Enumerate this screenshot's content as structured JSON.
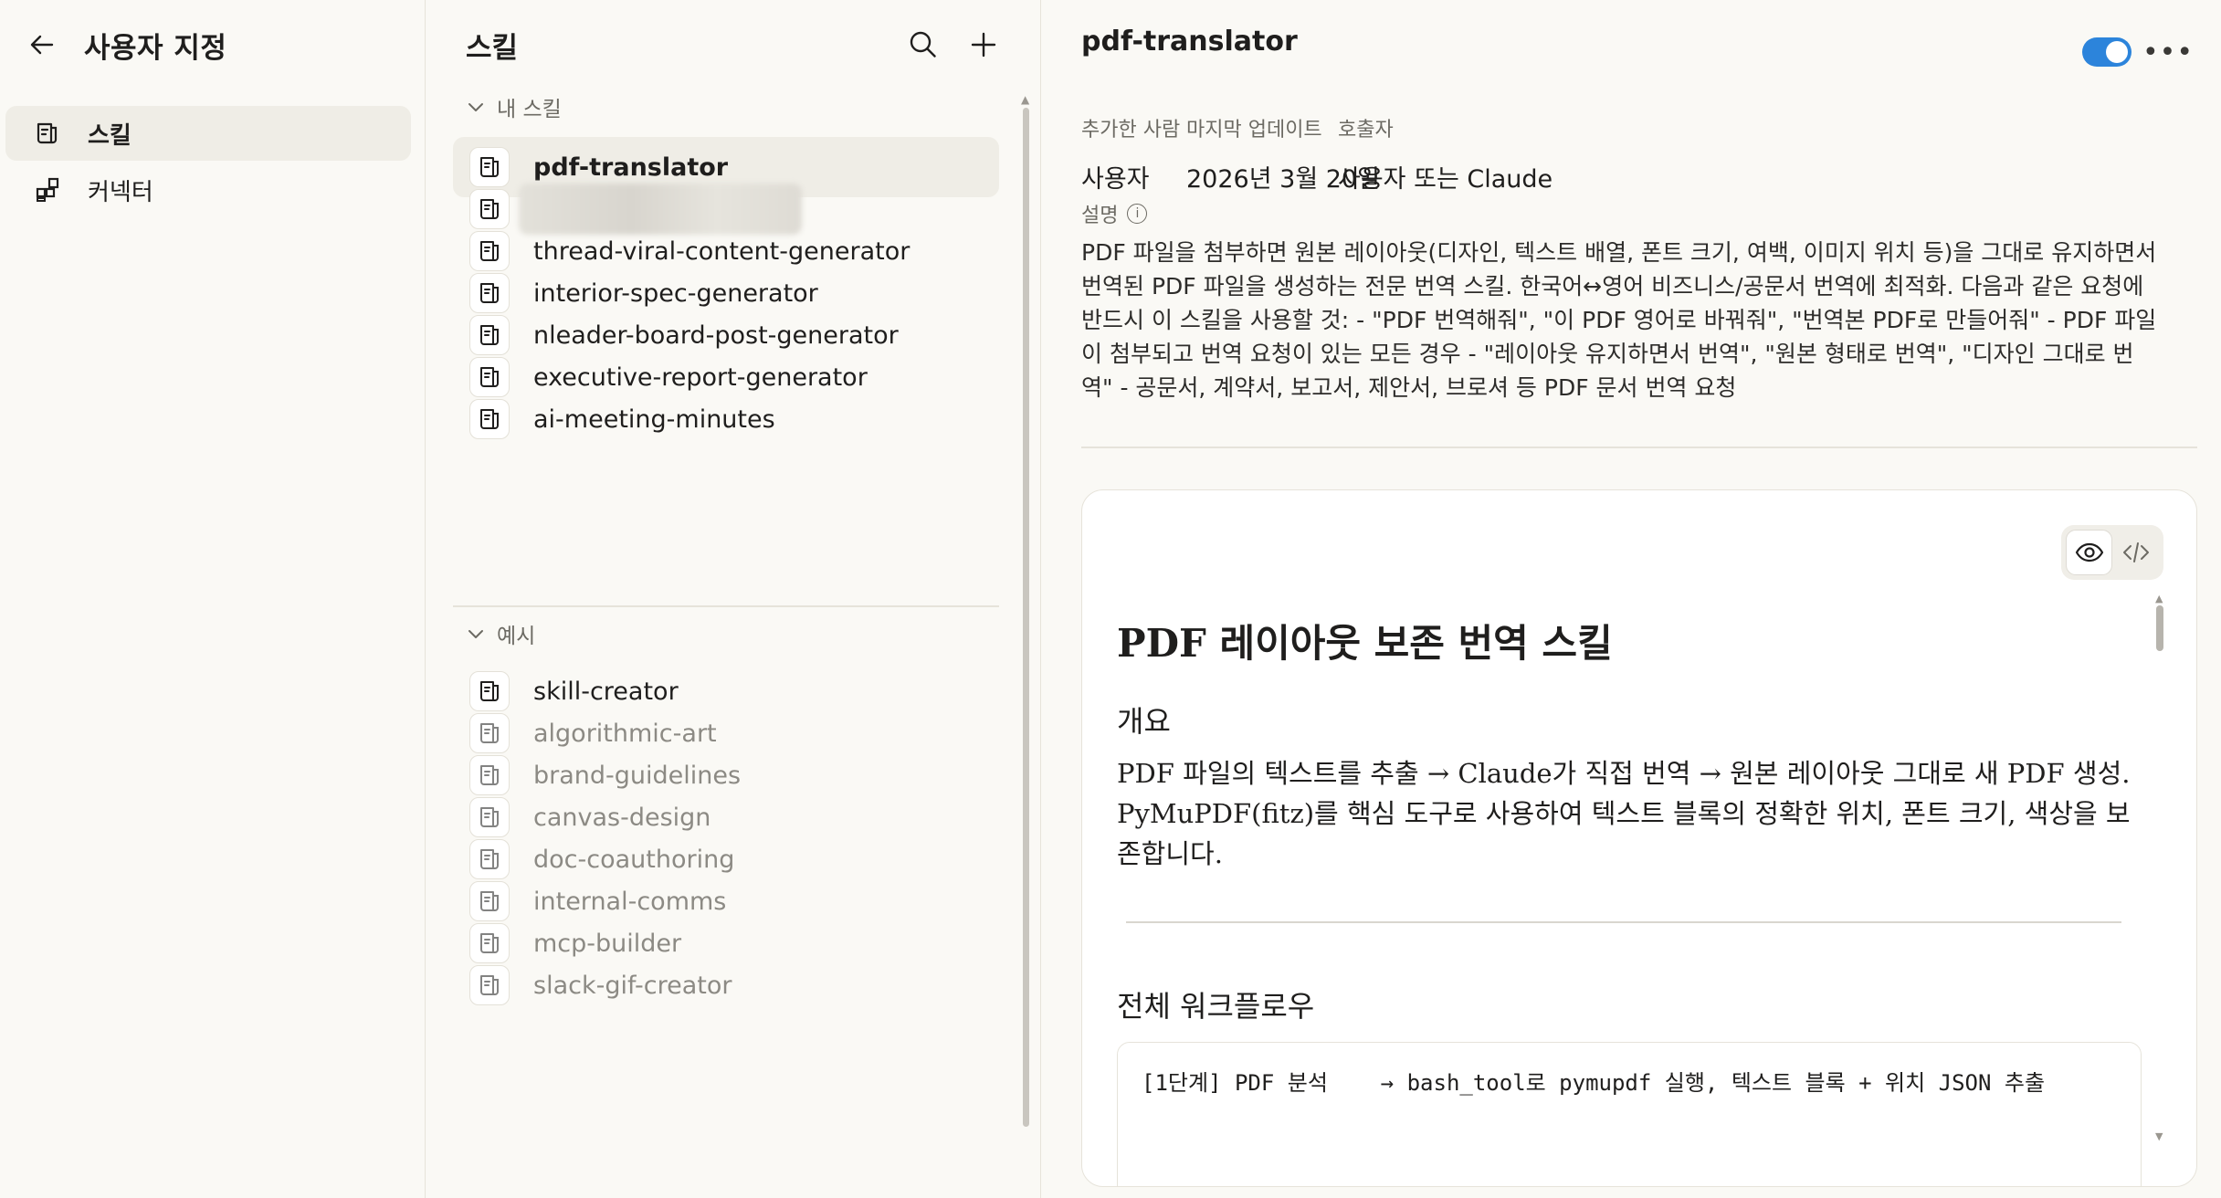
{
  "nav": {
    "title": "사용자 지정",
    "items": [
      {
        "label": "스킬",
        "icon": "skill-icon",
        "active": true
      },
      {
        "label": "커넥터",
        "icon": "connector-icon",
        "active": false
      }
    ]
  },
  "skills": {
    "title": "스킬",
    "sections": [
      {
        "label": "내 스킬",
        "items": [
          {
            "name": "pdf-translator",
            "active": true
          },
          {
            "name": "",
            "blurred": true
          },
          {
            "name": "thread-viral-content-generator"
          },
          {
            "name": "interior-spec-generator"
          },
          {
            "name": "nleader-board-post-generator"
          },
          {
            "name": "executive-report-generator"
          },
          {
            "name": "ai-meeting-minutes"
          }
        ]
      },
      {
        "label": "예시",
        "items": [
          {
            "name": "skill-creator"
          },
          {
            "name": "algorithmic-art",
            "dim": true
          },
          {
            "name": "brand-guidelines",
            "dim": true
          },
          {
            "name": "canvas-design",
            "dim": true
          },
          {
            "name": "doc-coauthoring",
            "dim": true
          },
          {
            "name": "internal-comms",
            "dim": true
          },
          {
            "name": "mcp-builder",
            "dim": true
          },
          {
            "name": "slack-gif-creator",
            "dim": true
          }
        ]
      }
    ]
  },
  "detail": {
    "title": "pdf-translator",
    "enabled": true,
    "meta": [
      {
        "key": "추가한 사람",
        "value": "사용자"
      },
      {
        "key": "마지막 업데이트",
        "value": "2026년 3월 20일"
      },
      {
        "key": "호출자",
        "value": "사용자 또는 Claude"
      }
    ],
    "description_label": "설명",
    "description": "PDF 파일을 첨부하면 원본 레이아웃(디자인, 텍스트 배열, 폰트 크기, 여백, 이미지 위치 등)을 그대로 유지하면서 번역된 PDF 파일을 생성하는 전문 번역 스킬. 한국어↔영어 비즈니스/공문서 번역에 최적화. 다음과 같은 요청에 반드시 이 스킬을 사용할 것: - \"PDF 번역해줘\", \"이 PDF 영어로 바꿔줘\", \"번역본 PDF로 만들어줘\" - PDF 파일이 첨부되고 번역 요청이 있는 모든 경우 - \"레이아웃 유지하면서 번역\", \"원본 형태로 번역\", \"디자인 그대로 번역\" - 공문서, 계약서, 보고서, 제안서, 브로셔 등 PDF 문서 번역 요청",
    "doc": {
      "h1": "PDF 레이아웃 보존 번역 스킬",
      "overview_heading": "개요",
      "overview_text": "PDF 파일의 텍스트를 추출 → Claude가 직접 번역 → 원본 레이아웃 그대로 새 PDF 생성. PyMuPDF(fitz)를 핵심 도구로 사용하여 텍스트 블록의 정확한 위치, 폰트 크기, 색상을 보존합니다.",
      "workflow_heading": "전체 워크플로우",
      "code": "[1단계] PDF 분석    → bash_tool로 pymupdf 실행, 텍스트 블록 + 위치 JSON 추출"
    }
  },
  "colors": {
    "accent": "#2c84db",
    "background": "#faf9f5",
    "active_item": "#efede6"
  }
}
